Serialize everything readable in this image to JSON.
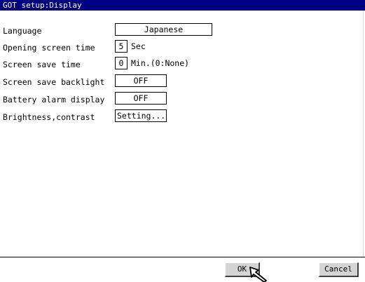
{
  "window": {
    "title": "GOT setup:Display"
  },
  "settings": {
    "language": {
      "label": "Language",
      "value": "Japanese"
    },
    "opening_screen_time": {
      "label": "Opening screen time",
      "value": "5",
      "unit": "Sec"
    },
    "screen_save_time": {
      "label": "Screen save time",
      "value": "0",
      "unit": "Min.(0:None)"
    },
    "screen_save_backlight": {
      "label": "Screen save backlight",
      "value": "OFF"
    },
    "battery_alarm_display": {
      "label": "Battery alarm display",
      "value": "OFF"
    },
    "brightness_contrast": {
      "label": "Brightness,contrast",
      "button": "Setting..."
    }
  },
  "footer": {
    "ok_label": "OK",
    "cancel_label": "Cancel"
  },
  "colors": {
    "title_bar": "#000080",
    "title_text": "#ffffff",
    "button_face": "#d4d4d4"
  },
  "icons": {
    "cursor": "mouse-pointer-icon"
  }
}
